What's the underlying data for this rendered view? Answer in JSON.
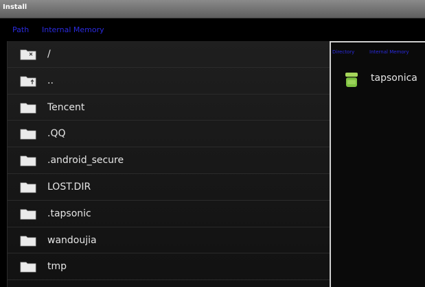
{
  "window": {
    "title": "Install"
  },
  "path_bar": {
    "label": "Path",
    "value": "Internal Memory"
  },
  "file_list": [
    {
      "name": "/",
      "icon": "folder-root-icon"
    },
    {
      "name": "..",
      "icon": "folder-up-icon"
    },
    {
      "name": "Tencent",
      "icon": "folder-icon"
    },
    {
      "name": ".QQ",
      "icon": "folder-icon"
    },
    {
      "name": ".android_secure",
      "icon": "folder-icon"
    },
    {
      "name": "LOST.DIR",
      "icon": "folder-icon"
    },
    {
      "name": ".tapsonic",
      "icon": "folder-icon"
    },
    {
      "name": "wandoujia",
      "icon": "folder-icon"
    },
    {
      "name": "tmp",
      "icon": "folder-icon"
    }
  ],
  "side_panel": {
    "header_label": "Directory",
    "header_value": "Internal Memory",
    "items": [
      {
        "name": "tapsonica",
        "icon": "android-apk-icon"
      }
    ]
  }
}
